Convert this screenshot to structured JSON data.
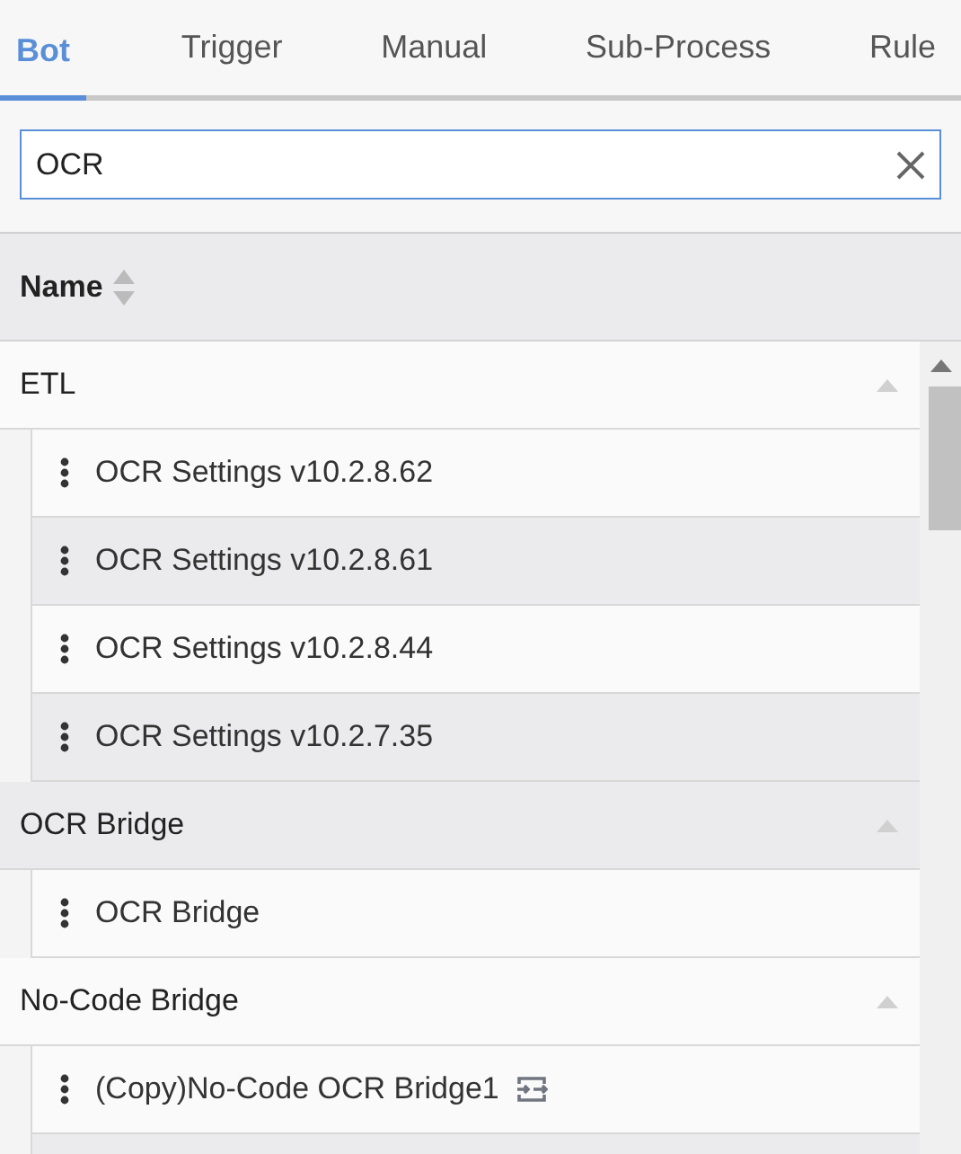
{
  "tabs": [
    {
      "label": "Bot",
      "selected": true
    },
    {
      "label": "Trigger",
      "selected": false
    },
    {
      "label": "Manual",
      "selected": false
    },
    {
      "label": "Sub-Process",
      "selected": false
    },
    {
      "label": "Rule",
      "selected": false
    }
  ],
  "search": {
    "value": "OCR"
  },
  "table": {
    "columns": [
      {
        "label": "Name"
      }
    ],
    "groups": [
      {
        "name": "ETL",
        "expanded": true,
        "items": [
          {
            "name": "OCR Settings v10.2.8.62",
            "linked": false
          },
          {
            "name": "OCR Settings v10.2.8.61",
            "linked": false
          },
          {
            "name": "OCR Settings v10.2.8.44",
            "linked": false
          },
          {
            "name": "OCR Settings v10.2.7.35",
            "linked": false
          }
        ]
      },
      {
        "name": "OCR Bridge",
        "expanded": true,
        "items": [
          {
            "name": "OCR Bridge",
            "linked": false
          }
        ]
      },
      {
        "name": "No-Code Bridge",
        "expanded": true,
        "items": [
          {
            "name": "(Copy)No-Code OCR Bridge1",
            "linked": true
          }
        ]
      }
    ]
  }
}
